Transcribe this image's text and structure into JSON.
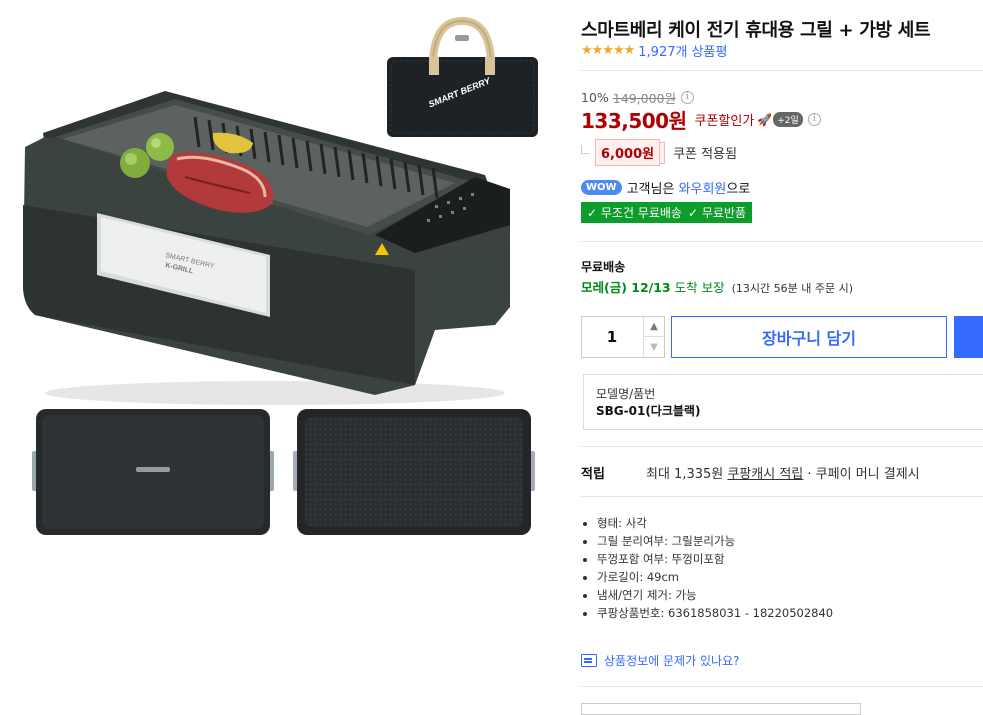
{
  "product": {
    "title": "스마트베리 케이 전기 휴대용 그릴 + 가방 세트",
    "stars": "★★★★★",
    "review_count": "1,927개 상품평"
  },
  "price": {
    "discount_rate": "10%",
    "original_price": "149,000원",
    "info_icon": "i",
    "sale_price": "133,500원",
    "coupon_text": "쿠폰할인가",
    "rocket_icon": "🚀",
    "rocket_badge": "+2일",
    "coupon_amount": "6,000원",
    "coupon_applied": "쿠폰 적용됨"
  },
  "wow": {
    "badge": "WOW",
    "text_prefix": "고객님은",
    "link": "와우회원",
    "text_suffix": "으로",
    "benefits": [
      "✓ 무조건 무료배송",
      "✓ 무료반품"
    ]
  },
  "shipping": {
    "label": "무료배송",
    "arrival_day": "모레(금) 12/13",
    "arrival_label": "도착 보장",
    "arrival_note": "(13시간 56분 내 주문 시)"
  },
  "purchase": {
    "quantity": "1",
    "up_glyph": "▲",
    "down_glyph": "▼",
    "cart_label": "장바구니 담기"
  },
  "model": {
    "label": "모델명/품번",
    "value": "SBG-01(다크블랙)"
  },
  "points": {
    "label": "적립",
    "prefix": "최대 1,335원",
    "link": "쿠팡캐시 적립",
    "suffix": "· 쿠페이 머니 결제시"
  },
  "specs": [
    "형태: 사각",
    "그릴 분리여부: 그릴분리가능",
    "뚜껑포함 여부: 뚜껑미포함",
    "가로길이: 49cm",
    "냄새/연기 제거: 가능",
    "쿠팡상품번호: 6361858031 - 18220502840"
  ],
  "report": {
    "label": "상품정보에 문제가 있나요?"
  },
  "images": {
    "bag_brand": "SMART BERRY",
    "grill_brand_top": "SMART BERRY",
    "grill_brand_bottom": "K-GRILL"
  },
  "colors": {
    "accent_blue": "#346aff",
    "price_red": "#ae0000",
    "benefit_green": "#0d9d2a",
    "grill_body": "#3a4340"
  }
}
